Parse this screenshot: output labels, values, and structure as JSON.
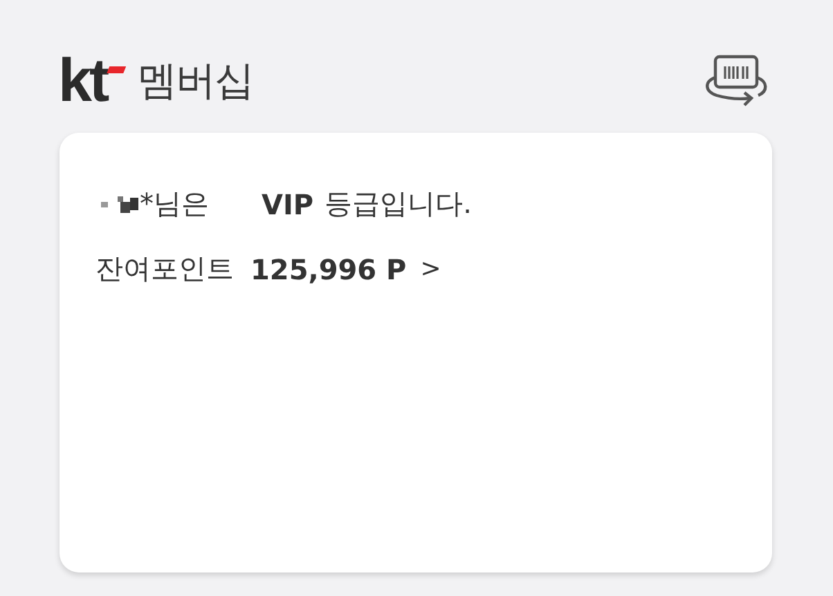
{
  "header": {
    "logo": "kt",
    "title": "멤버십"
  },
  "card": {
    "greeting": {
      "name_suffix": "*님은",
      "grade": "VIP",
      "tail": "등급입니다."
    },
    "points": {
      "label": "잔여포인트",
      "value": "125,996 P",
      "arrow": ">"
    }
  }
}
